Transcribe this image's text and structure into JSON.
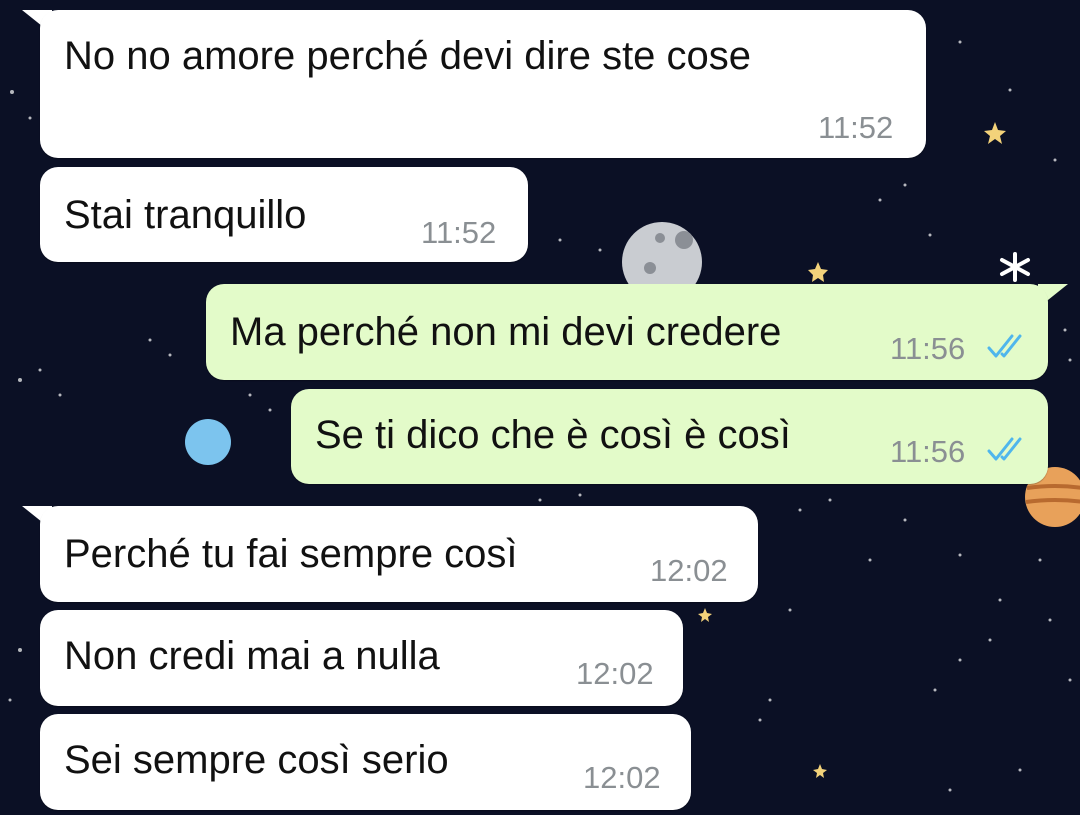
{
  "chat": {
    "messages": [
      {
        "direction": "incoming",
        "text": "No no amore perché devi dire ste cose",
        "time": "11:52"
      },
      {
        "direction": "incoming",
        "text": "Stai tranquillo",
        "time": "11:52"
      },
      {
        "direction": "outgoing",
        "text": "Ma perché non mi devi credere",
        "time": "11:56",
        "status": "read"
      },
      {
        "direction": "outgoing",
        "text": "Se ti dico che è così è così",
        "time": "11:56",
        "status": "read"
      },
      {
        "direction": "incoming",
        "text": "Perché tu fai sempre così",
        "time": "12:02"
      },
      {
        "direction": "incoming",
        "text": "Non credi mai a nulla",
        "time": "12:02"
      },
      {
        "direction": "incoming",
        "text": "Sei sempre così serio",
        "time": "12:02"
      }
    ]
  },
  "colors": {
    "wallpaper": "#0b1025",
    "incoming_bubble": "#ffffff",
    "outgoing_bubble": "#e3fbc9",
    "read_ticks": "#4fb6ec",
    "timestamp": "#8a8f93"
  },
  "icons": {
    "read_receipt": "double-check-icon"
  }
}
